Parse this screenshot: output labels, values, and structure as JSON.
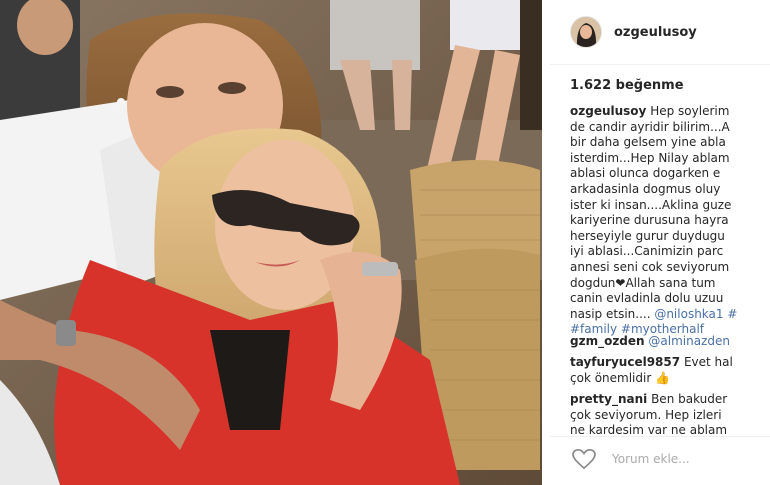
{
  "post": {
    "username": "ozgeulusoy",
    "likes": "1.622 beğenme",
    "caption_lines": [
      "Hep soylerim",
      "de candir ayridir bilirim...A",
      "bir daha gelsem yine abla",
      "isterdim...Hep Nilay ablam",
      "ablasi olunca dogarken e",
      "arkadasinla dogmus oluy",
      "ister ki insan....Aklina guze",
      "kariyerine durusuna hayra",
      "herseyiyle gurur duydugu",
      "iyi ablasi...Canimizin parc",
      "annesi seni cok seviyorum",
      "dogdun❤Allah sana tum",
      "canin evladinla dolu uzuu",
      "nasip etsin.... ",
      "#family #myotherhalf"
    ],
    "caption_mention": "@niloshka1 #",
    "comments": [
      {
        "username": "gzm_ozden",
        "lines": [
          "@alminazden"
        ]
      },
      {
        "username": "tayfuryucel9857",
        "lines": [
          "Evet hal",
          "çok önemlidir 👍"
        ]
      },
      {
        "username": "pretty_nani",
        "lines": [
          "Ben bakuder",
          "çok seviyorum. Hep izleri",
          "ne kardesim var ne ablam"
        ]
      }
    ],
    "comment_placeholder": "Yorum ekle...",
    "heart_icon": "heart-outline-icon"
  },
  "colors": {
    "link": "#4a6fa5",
    "text": "#262626",
    "red_jacket": "#d8332b"
  }
}
